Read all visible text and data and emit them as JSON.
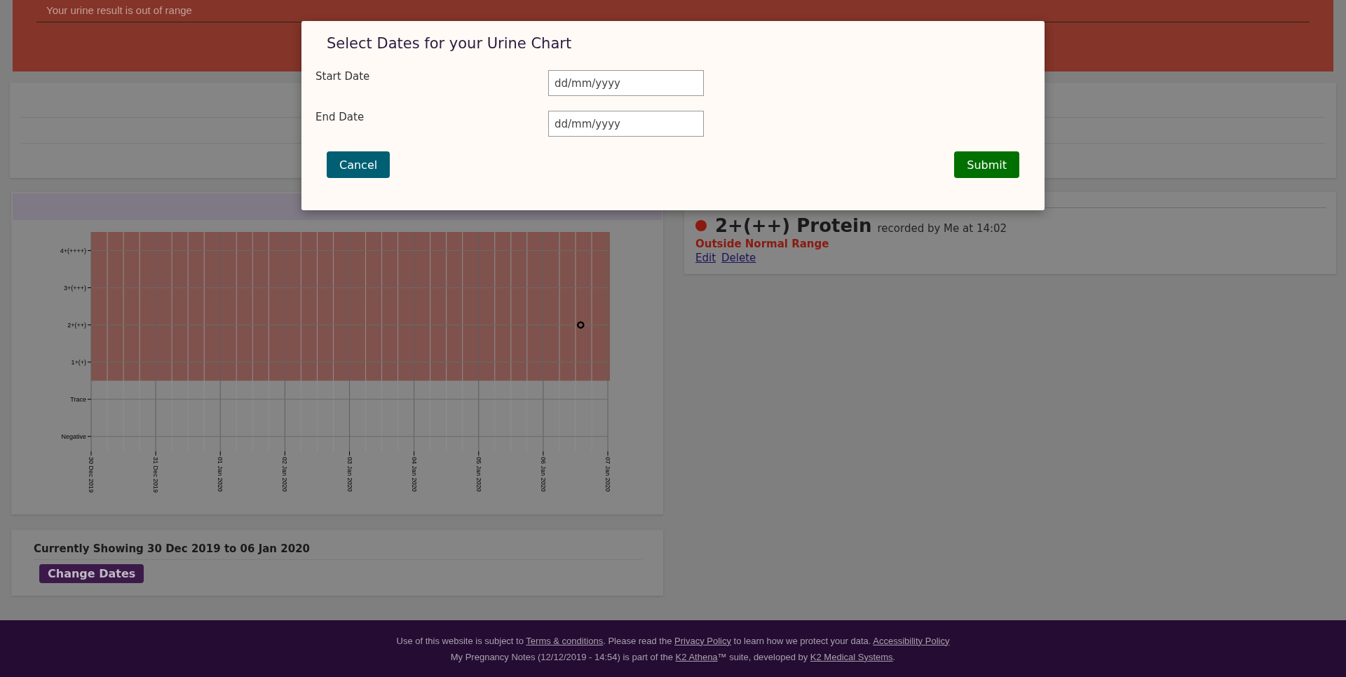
{
  "banner": {
    "message": "Your urine result is out of range"
  },
  "chart_panel": {
    "chart": {
      "y_labels": [
        "4+(++++)",
        "3+(+++)",
        "2+(++)",
        "1+(+)",
        "Trace",
        "Negative"
      ],
      "x_labels": [
        "30 Dec 2019",
        "31 Dec 2019",
        "01 Jan 2020",
        "02 Jan 2020",
        "03 Jan 2020",
        "04 Jan 2020",
        "05 Jan 2020",
        "06 Jan 2020",
        "07 Jan 2020"
      ]
    }
  },
  "range_panel": {
    "text": "Currently Showing 30 Dec 2019 to 06 Jan 2020",
    "button": "Change Dates"
  },
  "results_panel": {
    "results": [
      {
        "value": "2+(++) Protein",
        "recorded": "recorded by Me at 14:02",
        "status": "Outside Normal Range",
        "color": "#8b1a10",
        "actions": [
          "Edit",
          "Delete"
        ]
      }
    ]
  },
  "footer": {
    "lines": [
      [
        {
          "text": "Use of this website is subject to ",
          "kind": "text"
        },
        {
          "text": "Terms & conditions",
          "kind": "link"
        },
        {
          "text": ". Please read the ",
          "kind": "text"
        },
        {
          "text": "Privacy Policy",
          "kind": "link"
        },
        {
          "text": " to learn how we protect your data. ",
          "kind": "text"
        },
        {
          "text": "Accessibility Policy",
          "kind": "link"
        }
      ],
      [
        {
          "text": "My Pregnancy Notes (12/12/2019 - 14:54) is part of the ",
          "kind": "text"
        },
        {
          "text": "K2 Athena",
          "kind": "link"
        },
        {
          "text": "™ suite, developed by ",
          "kind": "text"
        },
        {
          "text": "K2 Medical Systems",
          "kind": "link"
        },
        {
          "text": ".",
          "kind": "text"
        }
      ]
    ]
  },
  "modal": {
    "title": "Select Dates for your Urine Chart",
    "fields": [
      {
        "label": "Start Date",
        "placeholder": "dd/mm/yyyy"
      },
      {
        "label": "End Date",
        "placeholder": "dd/mm/yyyy"
      }
    ],
    "buttons": [
      {
        "label": "Cancel",
        "kind": "cancel"
      },
      {
        "label": "Submit",
        "kind": "submit"
      }
    ]
  }
}
